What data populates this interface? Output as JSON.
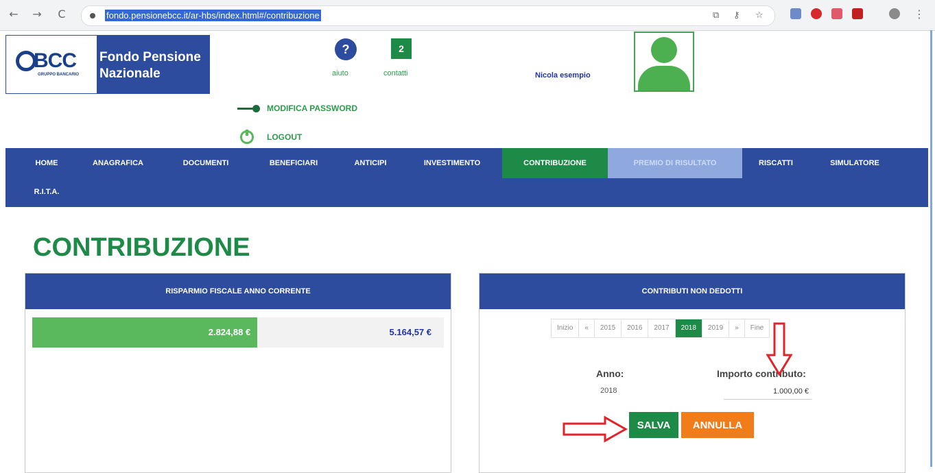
{
  "browser": {
    "url": "fondo.pensionebcc.it/ar-hbs/index.html#/contribuzione",
    "nav_back": "←",
    "nav_forward": "→",
    "nav_reload": "C"
  },
  "header": {
    "logo_brand": "BCC",
    "logo_subtitle": "GRUPPO BANCARIO",
    "fund_name_line1": "Fondo Pensione",
    "fund_name_line2": "Nazionale",
    "help_symbol": "?",
    "help_label": "aiuto",
    "contact_symbol": "2",
    "contact_label": "contatti",
    "username": "Nicola esempio",
    "modify_password": "MODIFICA PASSWORD",
    "logout": "LOGOUT"
  },
  "nav": {
    "items": [
      "HOME",
      "ANAGRAFICA",
      "DOCUMENTI",
      "BENEFICIARI",
      "ANTICIPI",
      "INVESTIMENTO",
      "CONTRIBUZIONE",
      "PREMIO DI RISULTATO",
      "RISCATTI",
      "SIMULATORE",
      "R.I.T.A."
    ],
    "active": "CONTRIBUZIONE"
  },
  "page": {
    "title": "CONTRIBUZIONE"
  },
  "savings_panel": {
    "title": "RISPARMIO FISCALE ANNO CORRENTE",
    "used_value": "2.824,88 €",
    "total_value": "5.164,57 €",
    "used_fraction": 0.547
  },
  "contrib_panel": {
    "title": "CONTRIBUTI NON DEDOTTI",
    "pager": [
      "Inizio",
      "«",
      "2015",
      "2016",
      "2017",
      "2018",
      "2019",
      "»",
      "Fine"
    ],
    "pager_active": "2018",
    "anno_label": "Anno:",
    "anno_value": "2018",
    "importo_label": "Importo contributo:",
    "importo_value": "1.000,00 €",
    "save_label": "SALVA",
    "cancel_label": "ANNULLA"
  },
  "colors": {
    "brand_blue": "#2e4c9e",
    "brand_green": "#1d8a47",
    "cancel_orange": "#f07d1a",
    "arrow_red": "#e0242b"
  }
}
